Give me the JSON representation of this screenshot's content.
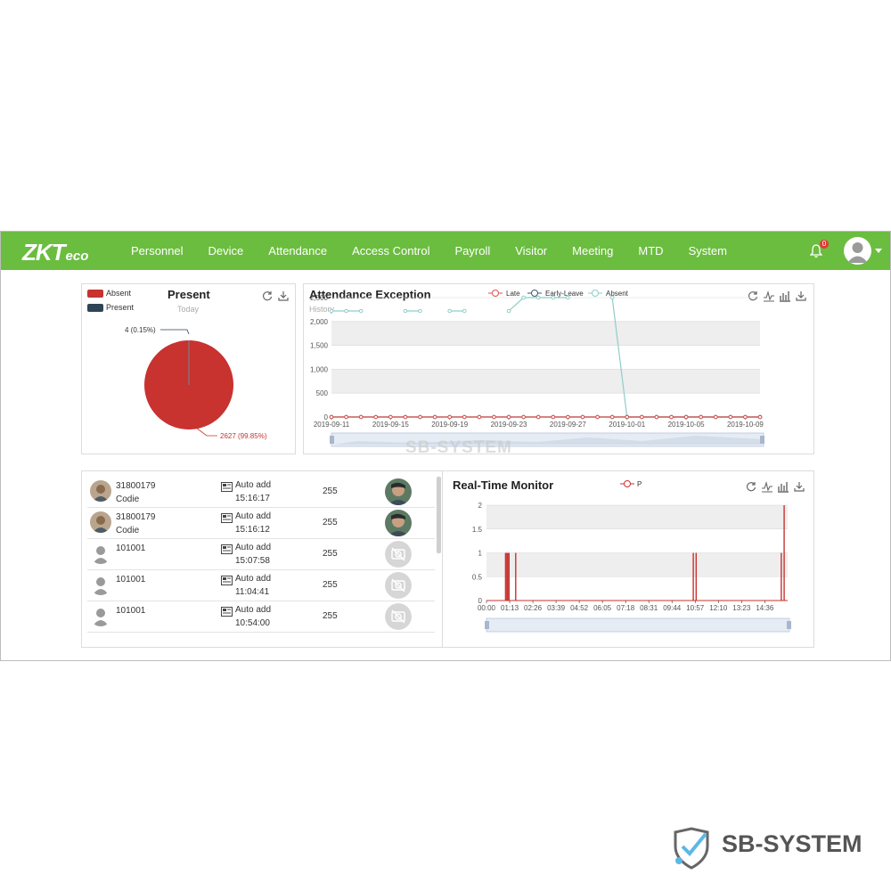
{
  "header": {
    "logo_main": "ZKT",
    "logo_sub": "eco",
    "nav": [
      "Personnel",
      "Device",
      "Attendance",
      "Access Control",
      "Payroll",
      "Visitor",
      "Meeting",
      "MTD",
      "System"
    ],
    "notification_count": "0"
  },
  "present_panel": {
    "title": "Present",
    "subtitle": "Today",
    "legend": [
      {
        "label": "Absent",
        "color": "#c8322f"
      },
      {
        "label": "Present",
        "color": "#2f4454"
      }
    ],
    "label_present": "4 (0.15%)",
    "label_absent": "2627 (99.85%)"
  },
  "exception_panel": {
    "title": "Attendance Exception",
    "subtitle": "History",
    "legend": [
      {
        "label": "Late",
        "color": "#d9534f"
      },
      {
        "label": "Early-Leave",
        "color": "#3d5a6c"
      },
      {
        "label": "Absent",
        "color": "#8fcdc8"
      }
    ]
  },
  "monitor_panel": {
    "title": "Real-Time Monitor",
    "legend": [
      {
        "label": "P",
        "color": "#c8322f"
      }
    ]
  },
  "records": [
    {
      "pin": "31800179",
      "name": "Codie",
      "mode": "Auto add",
      "time": "15:16:17",
      "code": "255",
      "has_photo": true
    },
    {
      "pin": "31800179",
      "name": "Codie",
      "mode": "Auto add",
      "time": "15:16:12",
      "code": "255",
      "has_photo": true
    },
    {
      "pin": "101001",
      "name": "",
      "mode": "Auto add",
      "time": "15:07:58",
      "code": "255",
      "has_photo": false
    },
    {
      "pin": "101001",
      "name": "",
      "mode": "Auto add",
      "time": "11:04:41",
      "code": "255",
      "has_photo": false
    },
    {
      "pin": "101001",
      "name": "",
      "mode": "Auto add",
      "time": "10:54:00",
      "code": "255",
      "has_photo": false
    }
  ],
  "chart_data": [
    {
      "type": "pie",
      "title": "Present",
      "subtitle": "Today",
      "slices": [
        {
          "label": "Absent",
          "value": 2627,
          "display": "2627 (99.85%)",
          "color": "#c8322f"
        },
        {
          "label": "Present",
          "value": 4,
          "display": "4 (0.15%)",
          "color": "#2f4454"
        }
      ]
    },
    {
      "type": "line",
      "title": "Attendance Exception",
      "subtitle": "History",
      "x": [
        "2019-09-11",
        "2019-09-12",
        "2019-09-13",
        "2019-09-14",
        "2019-09-15",
        "2019-09-16",
        "2019-09-17",
        "2019-09-18",
        "2019-09-19",
        "2019-09-20",
        "2019-09-21",
        "2019-09-22",
        "2019-09-23",
        "2019-09-24",
        "2019-09-25",
        "2019-09-26",
        "2019-09-27",
        "2019-09-28",
        "2019-09-29",
        "2019-09-30",
        "2019-10-01",
        "2019-10-02",
        "2019-10-03",
        "2019-10-04",
        "2019-10-05",
        "2019-10-06",
        "2019-10-07",
        "2019-10-08",
        "2019-10-09",
        "2019-10-10"
      ],
      "x_tick_labels": [
        "2019-09-11",
        "2019-09-15",
        "2019-09-19",
        "2019-09-23",
        "2019-09-27",
        "2019-10-01",
        "2019-10-05",
        "2019-10-09"
      ],
      "ylim": [
        0,
        2500
      ],
      "y_ticks": [
        "0",
        "500",
        "1,000",
        "1,500",
        "2,000",
        "2,500"
      ],
      "series": [
        {
          "name": "Late",
          "color": "#d9534f",
          "values": [
            0,
            0,
            0,
            0,
            0,
            0,
            0,
            0,
            0,
            0,
            0,
            0,
            0,
            0,
            0,
            0,
            0,
            0,
            0,
            0,
            0,
            0,
            0,
            0,
            0,
            0,
            0,
            0,
            0,
            0
          ]
        },
        {
          "name": "Early-Leave",
          "color": "#3d5a6c",
          "values": [
            0,
            0,
            0,
            0,
            0,
            0,
            0,
            0,
            0,
            0,
            0,
            0,
            0,
            0,
            0,
            0,
            0,
            0,
            0,
            0,
            0,
            0,
            0,
            0,
            0,
            0,
            0,
            0,
            0,
            0
          ]
        },
        {
          "name": "Absent",
          "color": "#8fcdc8",
          "values": [
            2220,
            2220,
            2220,
            null,
            null,
            2220,
            2220,
            null,
            2220,
            2220,
            null,
            null,
            2220,
            2500,
            2500,
            2500,
            2500,
            null,
            null,
            2500,
            0,
            0,
            0,
            0,
            0,
            0,
            0,
            0,
            0,
            0
          ]
        }
      ]
    },
    {
      "type": "bar",
      "title": "Real-Time Monitor",
      "ylim": [
        0,
        2
      ],
      "y_ticks": [
        "0",
        "0.5",
        "1",
        "1.5",
        "2"
      ],
      "x_tick_labels": [
        "00:00",
        "01:13",
        "02:26",
        "03:39",
        "04:52",
        "06:05",
        "07:18",
        "08:31",
        "09:44",
        "10:57",
        "12:10",
        "13:23",
        "14:36"
      ],
      "x_range_minutes": [
        0,
        948
      ],
      "series": [
        {
          "name": "P",
          "color": "#c8322f",
          "events": [
            {
              "minute": 60,
              "value": 1
            },
            {
              "minute": 64,
              "value": 1
            },
            {
              "minute": 67,
              "value": 1
            },
            {
              "minute": 71,
              "value": 1
            },
            {
              "minute": 92,
              "value": 1
            },
            {
              "minute": 651,
              "value": 1
            },
            {
              "minute": 660,
              "value": 1
            },
            {
              "minute": 928,
              "value": 1
            },
            {
              "minute": 937,
              "value": 2
            }
          ]
        }
      ]
    }
  ],
  "watermark": {
    "text": "SB-SYSTEM"
  }
}
